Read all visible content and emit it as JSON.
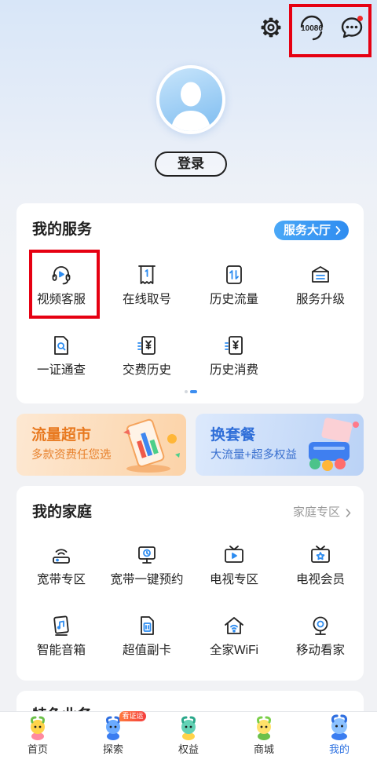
{
  "header": {
    "settings_icon": "gear-icon",
    "hotline_icon": "headset-icon",
    "hotline_number": "10086",
    "message_icon": "chat-bubble-icon",
    "has_unread_message": true,
    "avatar_icon": "user-avatar-icon",
    "login_label": "登录"
  },
  "services": {
    "title": "我的服务",
    "hall_label": "服务大厅",
    "items": [
      {
        "label": "视频客服",
        "icon": "video-support-icon"
      },
      {
        "label": "在线取号",
        "icon": "ticket-icon"
      },
      {
        "label": "历史流量",
        "icon": "traffic-history-icon"
      },
      {
        "label": "服务升级",
        "icon": "service-upgrade-icon"
      },
      {
        "label": "一证通查",
        "icon": "id-check-icon"
      },
      {
        "label": "交费历史",
        "icon": "payment-history-icon"
      },
      {
        "label": "历史消费",
        "icon": "consumption-history-icon"
      }
    ],
    "pager": {
      "pages": 2,
      "current": 2
    }
  },
  "banners": [
    {
      "title": "流量超市",
      "subtitle": "多款资费任您选",
      "title_color": "#e8791f",
      "icon": "traffic-market-illustration"
    },
    {
      "title": "换套餐",
      "subtitle": "大流量+超多权益",
      "title_color": "#2f6ed8",
      "icon": "change-plan-illustration"
    }
  ],
  "family": {
    "title": "我的家庭",
    "zone_label": "家庭专区",
    "items": [
      {
        "label": "宽带专区",
        "icon": "broadband-icon"
      },
      {
        "label": "宽带一键预约",
        "icon": "broadband-appointment-icon"
      },
      {
        "label": "电视专区",
        "icon": "tv-icon"
      },
      {
        "label": "电视会员",
        "icon": "tv-member-icon"
      },
      {
        "label": "智能音箱",
        "icon": "smart-speaker-icon"
      },
      {
        "label": "超值副卡",
        "icon": "sim-card-icon"
      },
      {
        "label": "全家WiFi",
        "icon": "home-wifi-icon"
      },
      {
        "label": "移动看家",
        "icon": "home-camera-icon"
      }
    ]
  },
  "featured": {
    "title": "特色业务"
  },
  "tabbar": {
    "tabs": [
      {
        "label": "首页",
        "icon": "home-mascot-icon"
      },
      {
        "label": "探索",
        "icon": "explore-mascot-icon"
      },
      {
        "label": "权益",
        "icon": "benefits-mascot-icon"
      },
      {
        "label": "商城",
        "icon": "mall-mascot-icon"
      },
      {
        "label": "我的",
        "icon": "mine-mascot-icon"
      }
    ],
    "active_index": 4,
    "badge": "看证运"
  },
  "colors": {
    "accent": "#2f8cf0",
    "active_tab": "#2a6fe0",
    "notification_dot": "#f02a2a",
    "annotation_box": "#e60012"
  }
}
